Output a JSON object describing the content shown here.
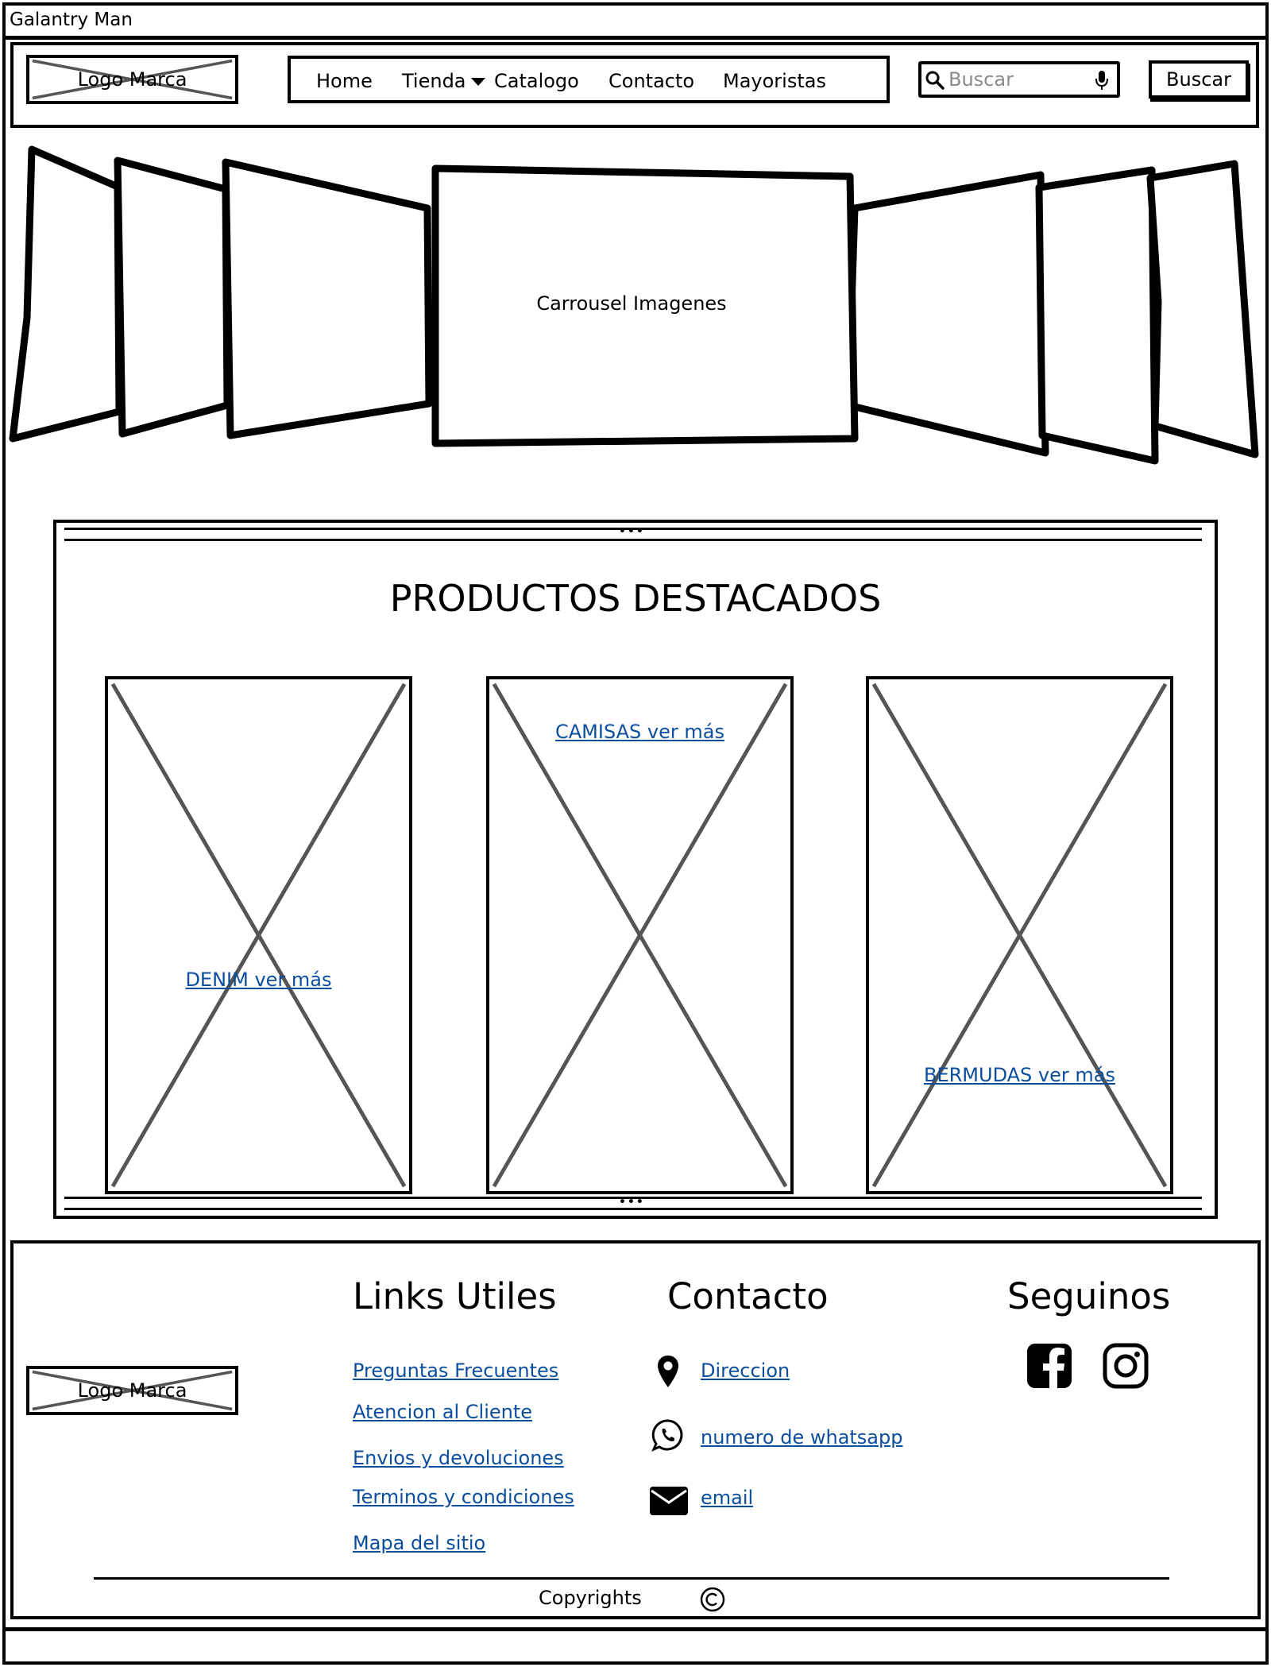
{
  "window": {
    "title": "Galantry Man"
  },
  "header": {
    "logo_label": "Logo Marca",
    "nav": [
      {
        "label": "Home"
      },
      {
        "label": "Tienda",
        "has_dropdown": true
      },
      {
        "label": "Catalogo"
      },
      {
        "label": "Contacto"
      },
      {
        "label": "Mayoristas"
      }
    ],
    "search": {
      "placeholder": "Buscar",
      "button_label": "Buscar"
    }
  },
  "carousel": {
    "caption": "Carrousel Imagenes"
  },
  "featured": {
    "title": "PRODUCTOS DESTACADOS",
    "products": [
      {
        "link": "DENIM ver más"
      },
      {
        "link": "CAMISAS ver más"
      },
      {
        "link": "BERMUDAS ver más"
      }
    ]
  },
  "footer": {
    "logo_label": "Logo Marca",
    "links_heading": "Links Utiles",
    "links": [
      "Preguntas Frecuentes",
      "Atencion al Cliente",
      "Envios y devoluciones",
      "Terminos y condiciones",
      "Mapa del sitio"
    ],
    "contact_heading": "Contacto",
    "contact": [
      {
        "icon": "map-pin-icon",
        "label": "Direccion"
      },
      {
        "icon": "whatsapp-icon",
        "label": "numero de whatsapp"
      },
      {
        "icon": "envelope-icon",
        "label": "email"
      }
    ],
    "social_heading": "Seguinos",
    "social": [
      {
        "icon": "facebook-icon"
      },
      {
        "icon": "instagram-icon"
      }
    ],
    "copyright": "Copyrights"
  },
  "colors": {
    "link": "#0b4e9e",
    "ink": "#000000",
    "placeholder_cross": "#555555"
  }
}
